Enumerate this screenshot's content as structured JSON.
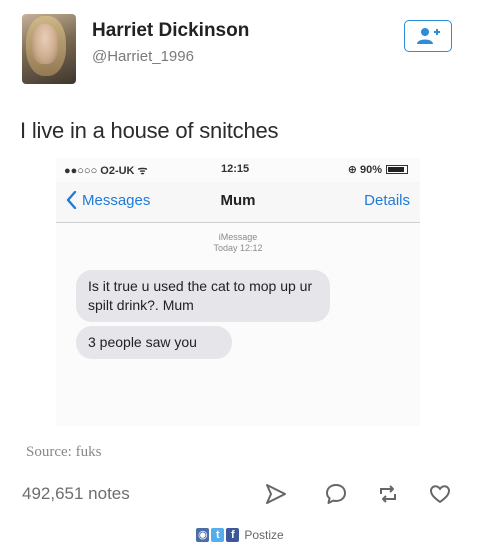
{
  "post": {
    "author_name": "Harriet Dickinson",
    "author_handle": "@Harriet_1996",
    "text": "I live in a house of snitches"
  },
  "phone": {
    "status": {
      "carrier": "●●○○○ O2-UK ᯤ",
      "time": "12:15",
      "battery_text": "⊕ 90%",
      "battery_level": 0.9
    },
    "nav": {
      "back_label": "Messages",
      "title": "Mum",
      "details_label": "Details"
    },
    "meta": {
      "service": "iMessage",
      "timestamp": "Today 12:12"
    },
    "messages": [
      {
        "text": "Is it true u used the cat to mop up ur spilt drink?. Mum"
      },
      {
        "text": "3 people saw you"
      }
    ]
  },
  "footer": {
    "source": "Source: fuks",
    "notes": "492,651 notes",
    "watermark": "Postize",
    "watermark_glyphs": [
      "◉",
      "t",
      "f"
    ]
  },
  "icons": {
    "follow": "add-user-icon",
    "share": "paper-plane-icon",
    "reply": "speech-bubble-icon",
    "reblog": "reblog-icon",
    "like": "heart-icon"
  },
  "colors": {
    "accent": "#2c8ed6",
    "ios_blue": "#1e7bd8",
    "bubble": "#e5e5ea",
    "muted": "#6e6e6e"
  }
}
